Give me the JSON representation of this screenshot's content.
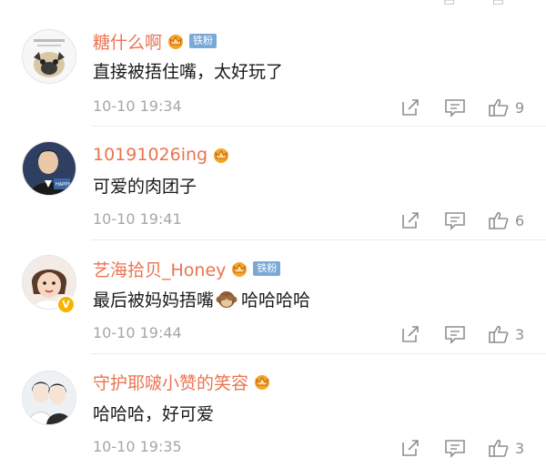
{
  "colors": {
    "username": "#eb7350",
    "timestamp": "#a6a6a6",
    "fan_badge": "#7aa9d6",
    "vip_crown": "#f5a623",
    "icon": "#8f8f8f"
  },
  "comments": [
    {
      "username": "糖什么啊",
      "has_vip_icon": true,
      "fan_badge": "铁粉",
      "text": "直接被捂住嘴，太好玩了",
      "timestamp": "10-10 19:34",
      "likes": "9",
      "avatar_icon": "pug-avatar-icon"
    },
    {
      "username": "10191026ing",
      "has_vip_icon": true,
      "fan_badge": "",
      "text": "可爱的肉团子",
      "timestamp": "10-10 19:41",
      "likes": "6",
      "avatar_icon": "man-portrait-avatar-icon"
    },
    {
      "username": "艺海拾贝_Honey",
      "has_vip_icon": true,
      "fan_badge": "铁粉",
      "text_before_emoji": "最后被妈妈捂嘴",
      "text_emoji": "see-no-evil-monkey-emoji",
      "text_after_emoji": "哈哈哈哈",
      "timestamp": "10-10 19:44",
      "likes": "3",
      "avatar_icon": "child-portrait-avatar-icon",
      "verified": true
    },
    {
      "username": "守护耶啵小赞的笑容",
      "has_vip_icon": true,
      "fan_badge": "",
      "text": "哈哈哈，好可爱",
      "timestamp": "10-10 19:35",
      "likes": "3",
      "avatar_icon": "illustrated-couple-avatar-icon"
    }
  ]
}
